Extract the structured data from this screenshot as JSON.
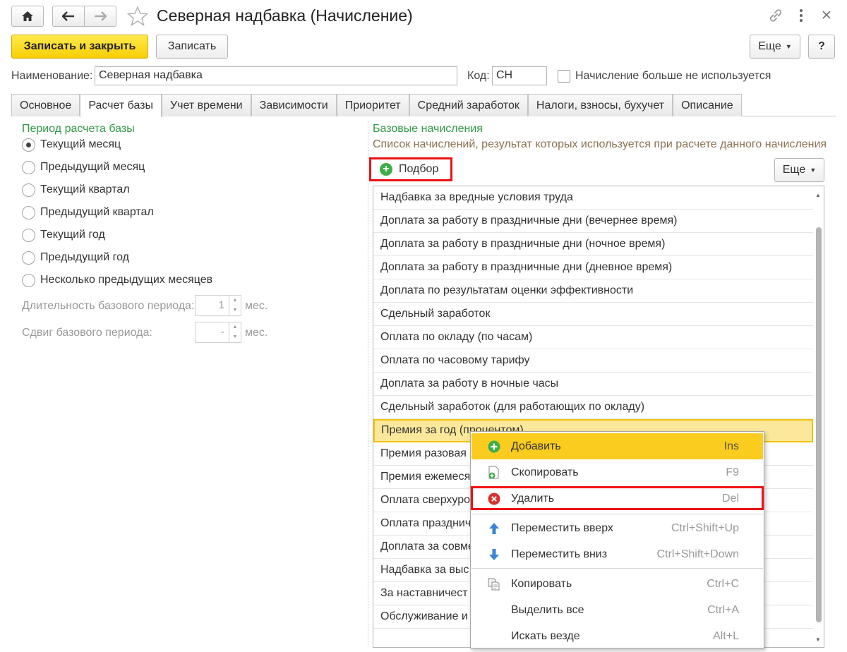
{
  "window": {
    "title": "Северная надбавка (Начисление)"
  },
  "toolbar": {
    "save_close": "Записать и закрыть",
    "save": "Записать",
    "more": "Еще",
    "help": "?"
  },
  "form": {
    "name_label": "Наименование:",
    "name_value": "Северная надбавка",
    "code_label": "Код:",
    "code_value": "СН",
    "unused_label": "Начисление больше не используется",
    "unused_checked": false
  },
  "tabs": [
    {
      "label": "Основное",
      "active": false
    },
    {
      "label": "Расчет базы",
      "active": true
    },
    {
      "label": "Учет времени",
      "active": false
    },
    {
      "label": "Зависимости",
      "active": false
    },
    {
      "label": "Приоритет",
      "active": false
    },
    {
      "label": "Средний заработок",
      "active": false
    },
    {
      "label": "Налоги, взносы, бухучет",
      "active": false
    },
    {
      "label": "Описание",
      "active": false
    }
  ],
  "period": {
    "title": "Период расчета базы",
    "options": [
      "Текущий месяц",
      "Предыдущий месяц",
      "Текущий квартал",
      "Предыдущий квартал",
      "Текущий год",
      "Предыдущий год",
      "Несколько предыдущих месяцев"
    ],
    "selected_index": 0,
    "duration_label": "Длительность базового периода:",
    "duration_value": "1",
    "duration_unit": "мес.",
    "shift_label": "Сдвиг базового периода:",
    "shift_value": "-",
    "shift_unit": "мес."
  },
  "base": {
    "title": "Базовые начисления",
    "subtitle": "Список начислений, результат которых используется при расчете данного начисления",
    "pick_button": "Подбор",
    "more": "Еще",
    "items": [
      "Надбавка за вредные условия труда",
      "Доплата за работу в праздничные дни (вечернее время)",
      "Доплата за работу в праздничные дни (ночное время)",
      "Доплата за работу в праздничные дни (дневное время)",
      "Доплата по результатам оценки эффективности",
      "Сдельный заработок",
      "Оплата по окладу (по часам)",
      "Оплата по часовому тарифу",
      "Доплата за работу в ночные часы",
      "Сдельный заработок (для работающих по окладу)",
      "Премия за год (процентом)",
      "Премия разовая",
      "Премия ежемеся",
      "Оплата сверхуроч",
      "Оплата празднич",
      "Доплата за совме",
      "Надбавка за выс",
      "За наставничест",
      "Обслуживание и р"
    ],
    "selected_index": 10
  },
  "context_menu": {
    "items": [
      {
        "label": "Добавить",
        "shortcut": "Ins",
        "icon": "plus-icon"
      },
      {
        "label": "Скопировать",
        "shortcut": "F9",
        "icon": "copy-doc-icon"
      },
      {
        "label": "Удалить",
        "shortcut": "Del",
        "icon": "delete-icon"
      },
      {
        "label": "Переместить вверх",
        "shortcut": "Ctrl+Shift+Up",
        "icon": "arrow-up-icon"
      },
      {
        "label": "Переместить вниз",
        "shortcut": "Ctrl+Shift+Down",
        "icon": "arrow-down-icon"
      },
      {
        "label": "Копировать",
        "shortcut": "Ctrl+C",
        "icon": "clipboard-copy-icon"
      },
      {
        "label": "Выделить все",
        "shortcut": "Ctrl+A",
        "icon": ""
      },
      {
        "label": "Искать везде",
        "shortcut": "Alt+L",
        "icon": ""
      }
    ]
  }
}
